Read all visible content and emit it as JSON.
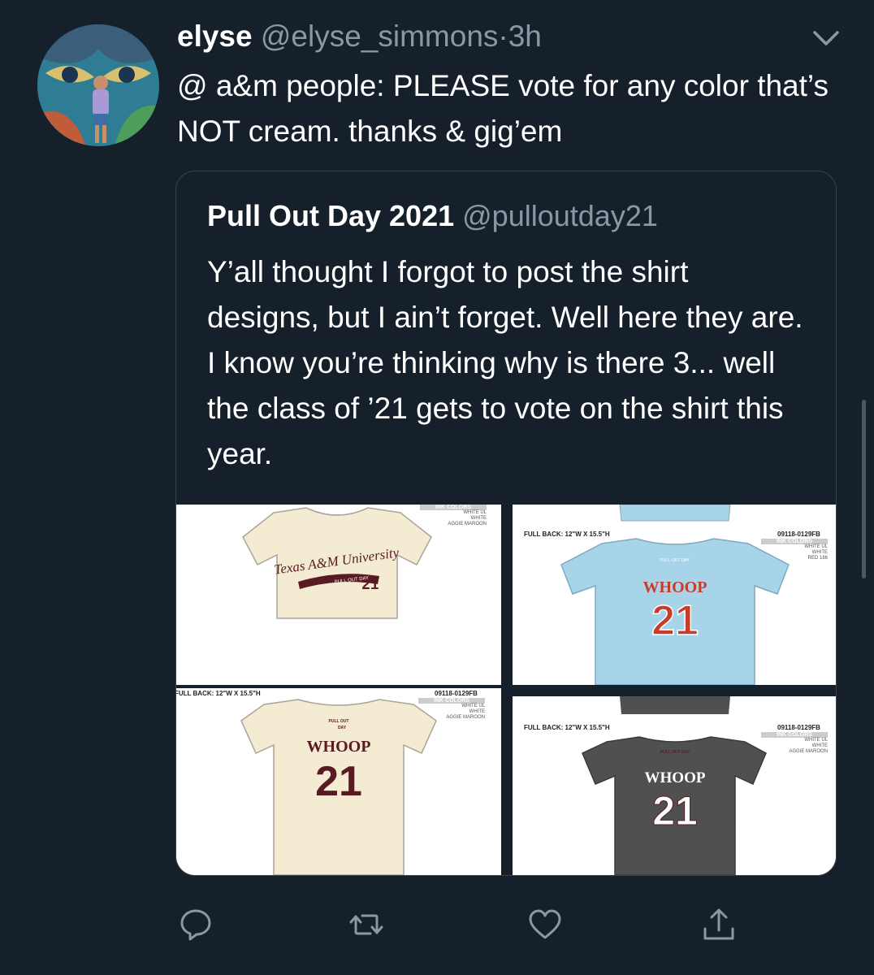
{
  "tweet": {
    "name": "elyse",
    "handle": "@elyse_simmons",
    "dot": "·",
    "time": "3h",
    "text": "@ a&m people: PLEASE vote for any color that’s NOT cream. thanks & gig’em",
    "avatar_icon": "profile-photo"
  },
  "quoted": {
    "name": "Pull Out Day 2021",
    "handle": "@pulloutday21",
    "text": "Y’all thought I forgot to post the shirt designs, but I ain’t forget. Well here they are. I know you’re thinking why is there 3... well the class of ’21 gets to vote on the shirt this year."
  },
  "media": {
    "panel1": {
      "shirt_color": "#f3ebd2",
      "front_script": "Texas A&M University",
      "front_banner": "PULL OUT DAY",
      "front_number": "21",
      "ink_header": "INK COLORS",
      "inks": [
        "WHITE UL",
        "WHITE",
        "AGGIE MAROON"
      ]
    },
    "panel2": {
      "shirt_color": "#a8d4ea",
      "spec": "FULL BACK: 12\"W X 15.5\"H",
      "code": "09118-0129FB",
      "ink_header": "INK COLORS",
      "inks": [
        "WHITE UL",
        "WHITE",
        "RED 186"
      ],
      "back_word": "WHOOP",
      "back_number": "21",
      "ink_color": "#c83c2c"
    },
    "panel3": {
      "shirt_color": "#f3ebd2",
      "spec": "FULL BACK: 12\"W X 15.5\"H",
      "code": "09118-0129FB",
      "ink_header": "INK COLORS",
      "inks": [
        "WHITE UL",
        "WHITE",
        "AGGIE MAROON"
      ],
      "small_logo_1": "PULL OUT",
      "small_logo_2": "DAY",
      "back_word": "WHOOP",
      "back_number": "21",
      "ink_color": "#5a1a22"
    },
    "panel4": {
      "shirt_color": "#505050",
      "spec": "FULL BACK: 12\"W X 15.5\"H",
      "code": "09118-0129FB",
      "ink_header": "INK COLORS",
      "inks": [
        "WHITE UL",
        "WHITE",
        "AGGIE MAROON"
      ],
      "back_word": "WHOOP",
      "back_number": "21",
      "ink_color": "#ffffff"
    }
  },
  "actions": [
    "reply-icon",
    "retweet-icon",
    "like-icon",
    "share-icon"
  ],
  "colors": {
    "background": "#15202b",
    "secondary_text": "#8899a6",
    "border": "#38444d",
    "maroon": "#5a1a22"
  }
}
